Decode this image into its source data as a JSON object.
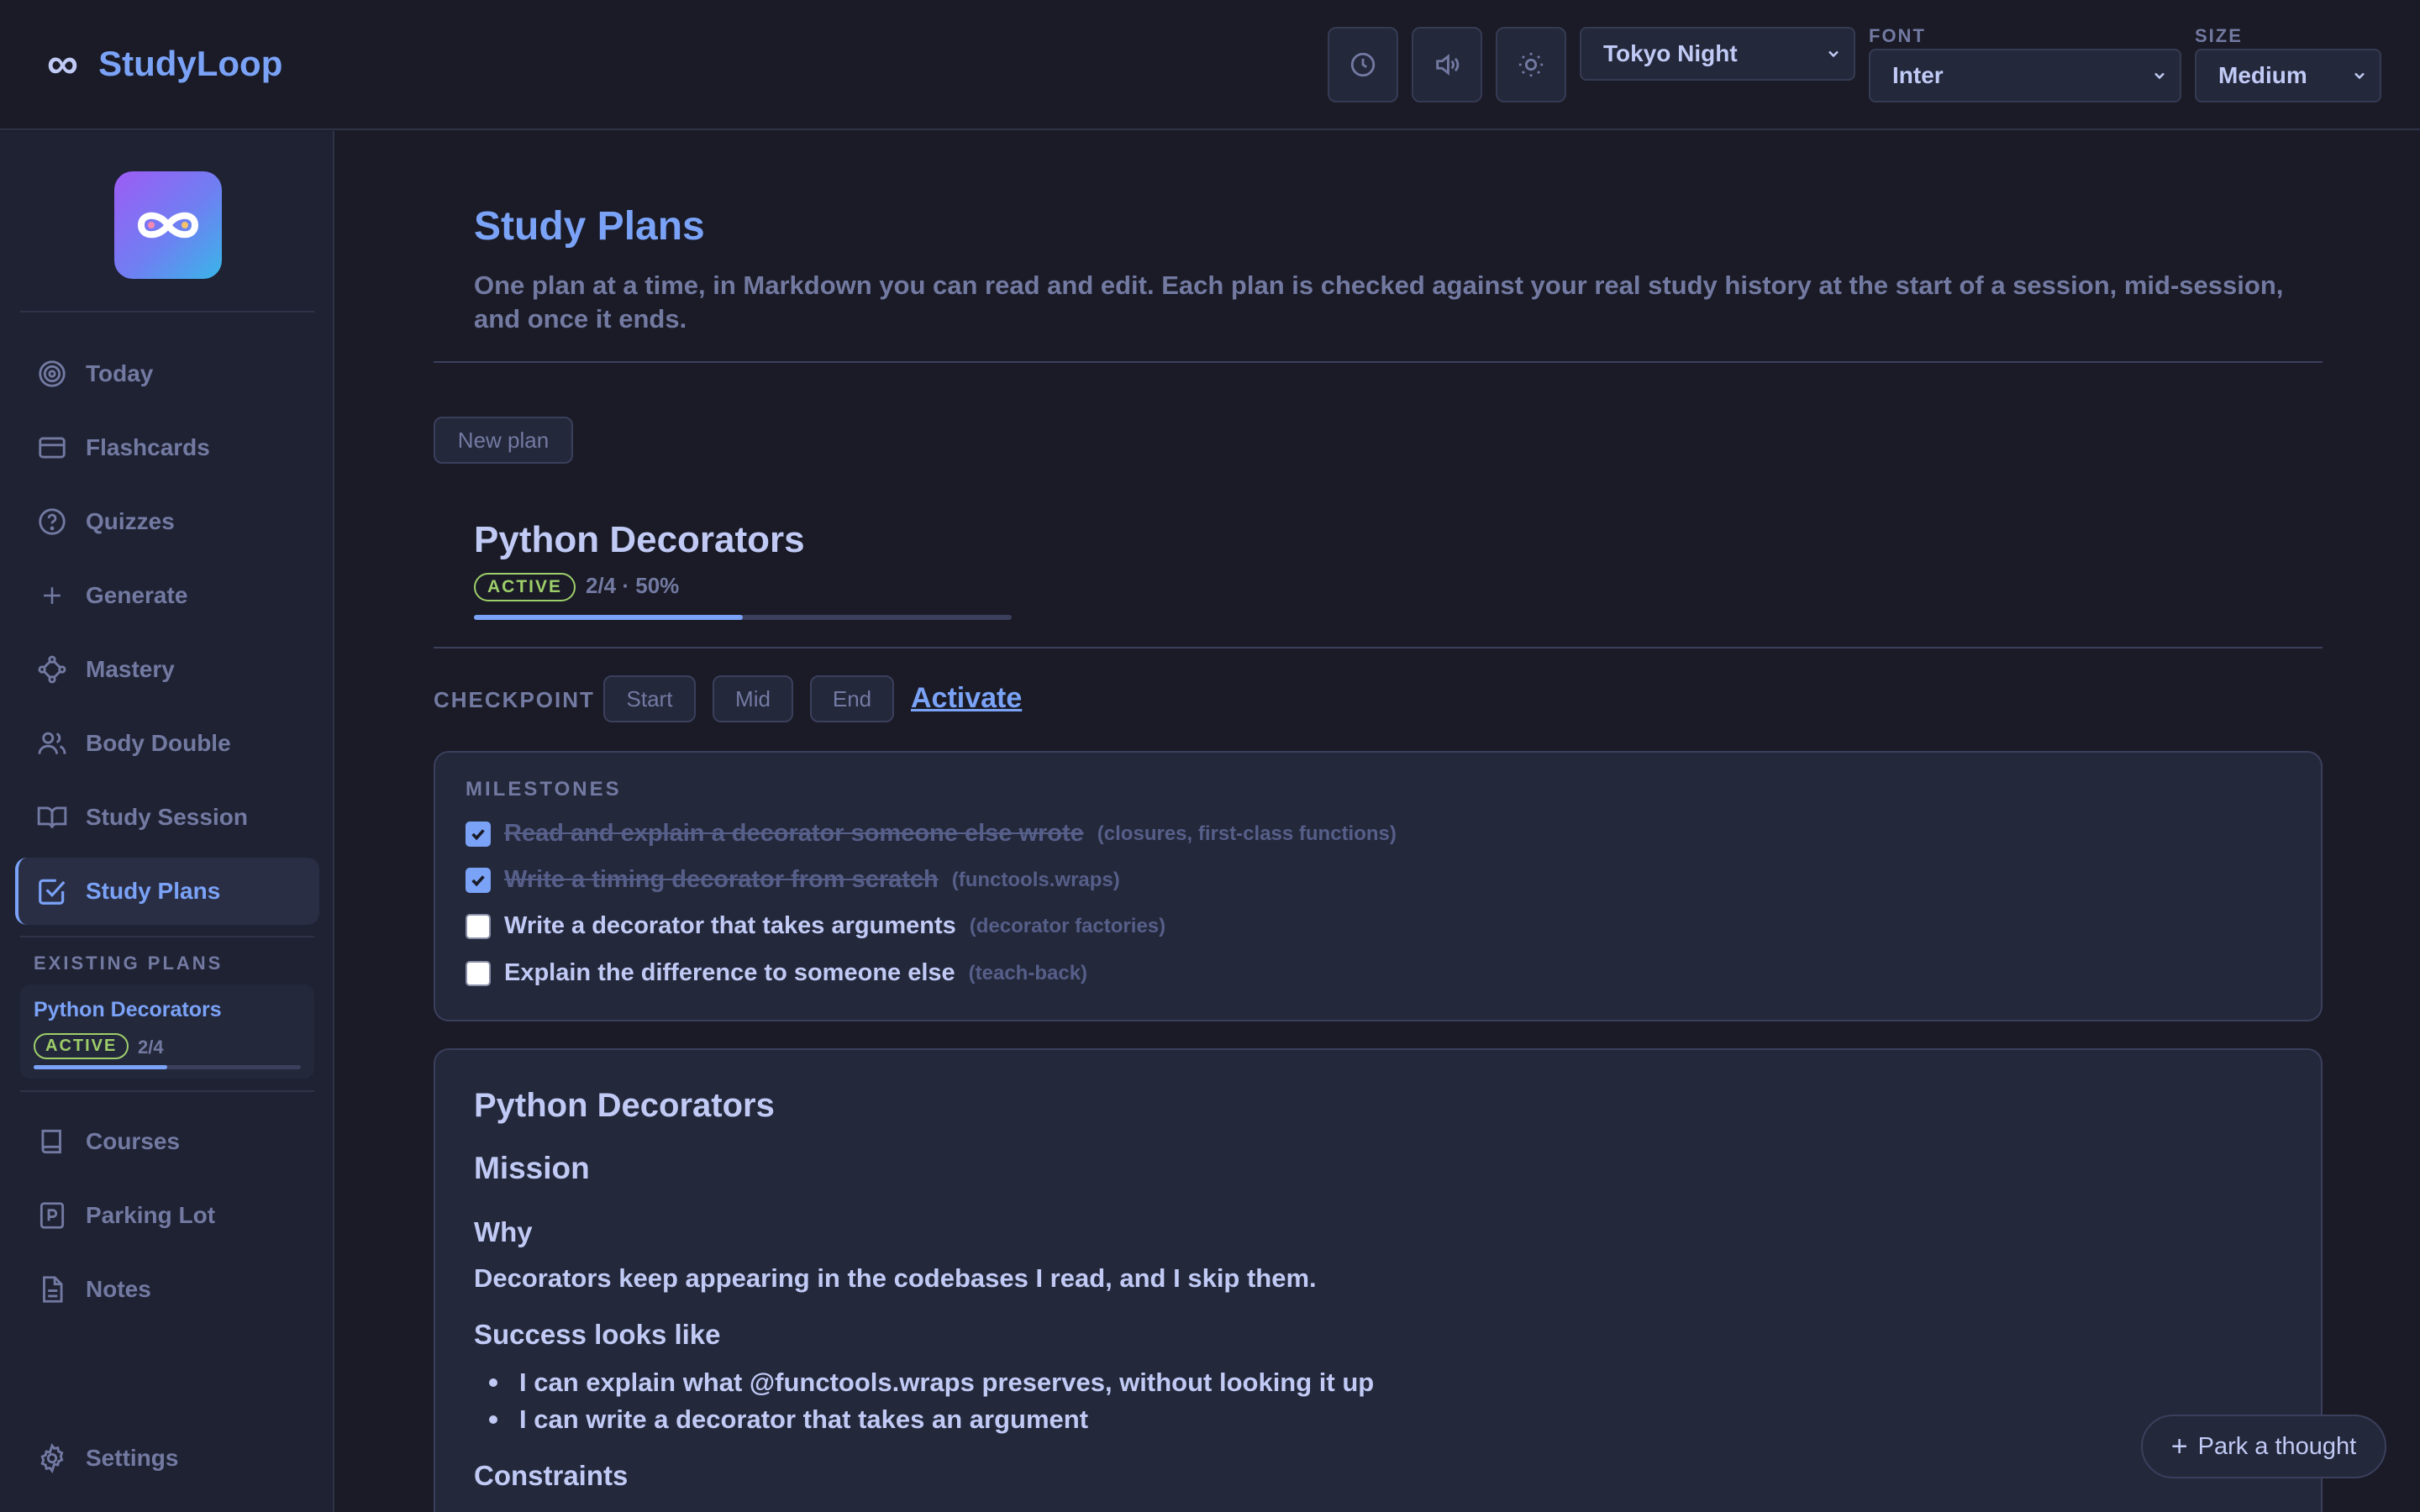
{
  "app": {
    "name": "StudyLoop"
  },
  "topbar": {
    "theme": {
      "value": "Tokyo Night"
    },
    "font": {
      "label": "FONT",
      "value": "Inter"
    },
    "size": {
      "label": "SIZE",
      "value": "Medium"
    },
    "icons": [
      "clock-icon",
      "volume-icon",
      "sun-icon"
    ]
  },
  "sidebar": {
    "nav": [
      {
        "label": "Today",
        "icon": "target-icon"
      },
      {
        "label": "Flashcards",
        "icon": "card-icon"
      },
      {
        "label": "Quizzes",
        "icon": "question-icon"
      },
      {
        "label": "Generate",
        "icon": "plus-icon"
      },
      {
        "label": "Mastery",
        "icon": "network-icon"
      },
      {
        "label": "Body Double",
        "icon": "users-icon"
      },
      {
        "label": "Study Session",
        "icon": "book-open-icon"
      },
      {
        "label": "Study Plans",
        "icon": "check-square-icon",
        "active": true
      }
    ],
    "existing_title": "EXISTING PLANS",
    "existing_plans": [
      {
        "title": "Python Decorators",
        "badge": "ACTIVE",
        "count": "2/4",
        "progress": 0.5
      }
    ],
    "nav2": [
      {
        "label": "Courses",
        "icon": "book-icon"
      },
      {
        "label": "Parking Lot",
        "icon": "parking-icon"
      },
      {
        "label": "Notes",
        "icon": "file-icon"
      }
    ],
    "settings": {
      "label": "Settings",
      "icon": "gear-icon"
    }
  },
  "main": {
    "title": "Study Plans",
    "description": "One plan at a time, in Markdown you can read and edit. Each plan is checked against your real study history at the start of a session, mid-session, and once it ends.",
    "new_plan_label": "New plan",
    "plan": {
      "title": "Python Decorators",
      "badge": "ACTIVE",
      "progress_text": "2/4 · 50%",
      "progress": 0.5
    },
    "checkpoint": {
      "label": "CHECKPOINT",
      "buttons": [
        "Start",
        "Mid",
        "End"
      ],
      "activate_label": "Activate"
    },
    "milestones": {
      "title": "MILESTONES",
      "items": [
        {
          "text": "Read and explain a decorator someone else wrote",
          "hint": "(closures, first-class functions)",
          "done": true
        },
        {
          "text": "Write a timing decorator from scratch",
          "hint": "(functools.wraps)",
          "done": true
        },
        {
          "text": "Write a decorator that takes arguments",
          "hint": "(decorator factories)",
          "done": false
        },
        {
          "text": "Explain the difference to someone else",
          "hint": "(teach-back)",
          "done": false
        }
      ]
    },
    "markdown": {
      "h1": "Python Decorators",
      "mission": "Mission",
      "why": "Why",
      "why_text": "Decorators keep appearing in the codebases I read, and I skip them.",
      "success": "Success looks like",
      "success_items": [
        "I can explain what @functools.wraps preserves, without looking it up",
        "I can write a decorator that takes an argument"
      ],
      "constraints": "Constraints"
    }
  },
  "park_thought": {
    "label": "Park a thought"
  },
  "colors": {
    "background": "#1a1b26",
    "surface": "#24283b",
    "accent": "#7aa2f7",
    "active_badge": "#9ece6a",
    "muted": "#737aa2",
    "text": "#c0caf5"
  }
}
